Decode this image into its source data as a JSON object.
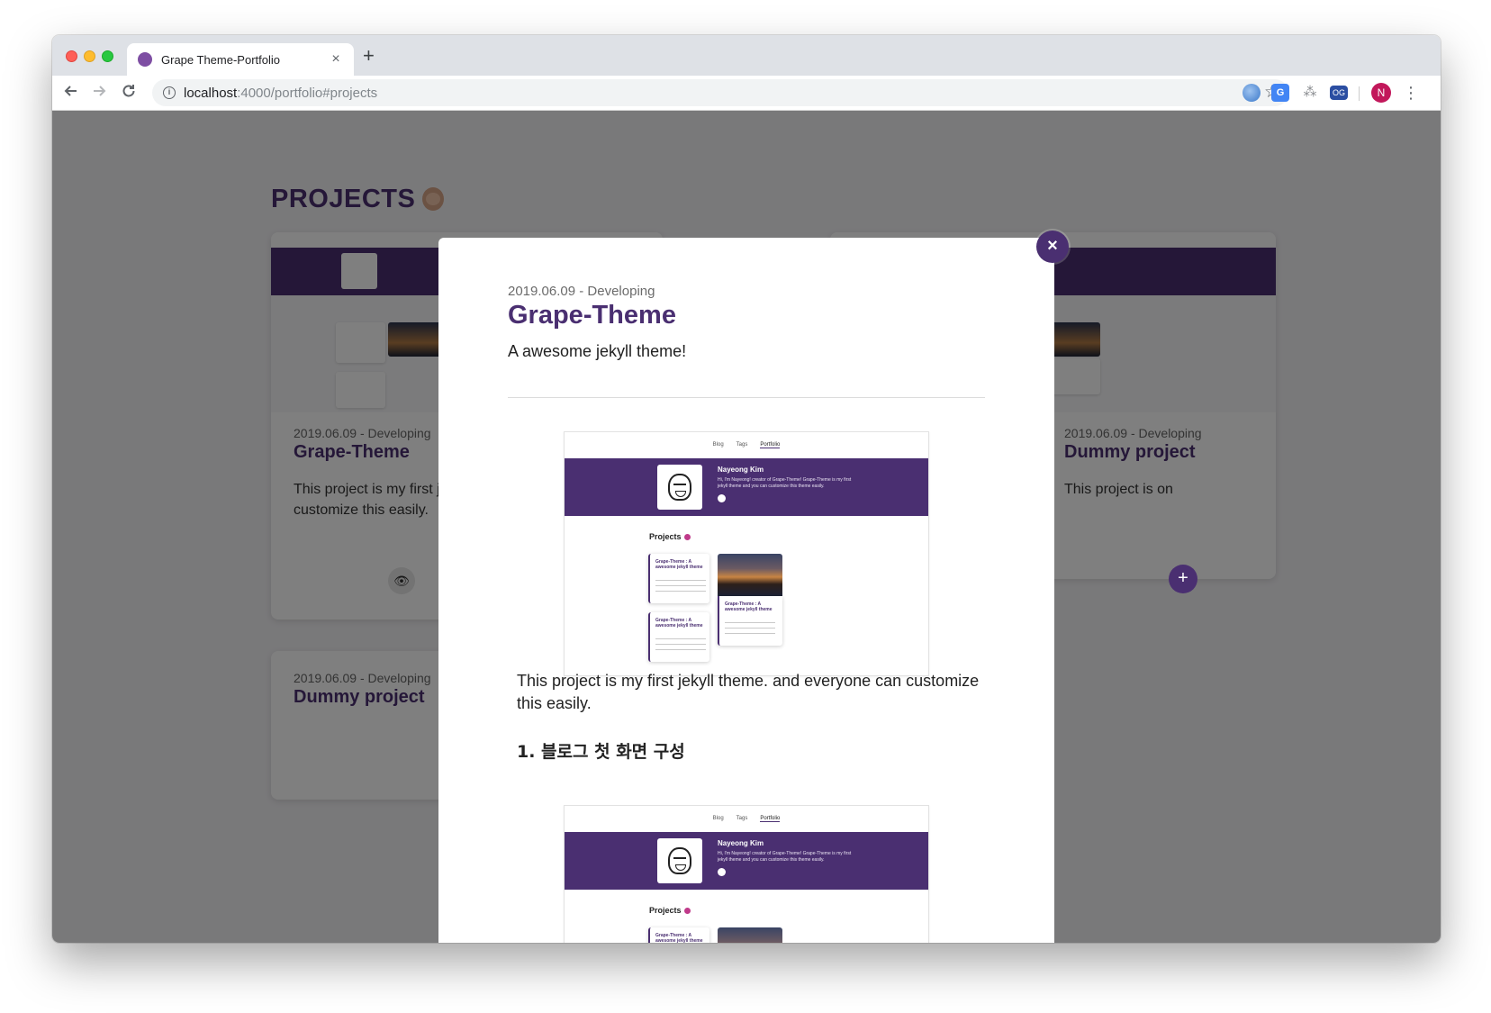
{
  "browser": {
    "tab_title": "Grape Theme-Portfolio",
    "tab_close": "×",
    "new_tab": "+",
    "url_host": "localhost",
    "url_rest": ":4000/portfolio#projects",
    "avatar_letter": "N",
    "ext_translate": "G",
    "ext_og": "OG",
    "icons": [
      "back-icon",
      "forward-icon",
      "reload-icon",
      "info-icon",
      "star-icon",
      "menu-icon"
    ]
  },
  "page": {
    "section_title": "PROJECTS",
    "cards": [
      {
        "date": "2019.06.09 - Developing",
        "title": "Grape-Theme",
        "description": "This project is my first jekyll theme. and everyone can customize this easily."
      },
      {
        "date": "2019.06.09 - Developing",
        "title": "Dummy project",
        "description": "This project is on"
      },
      {
        "date": "2019.06.09 - Developing",
        "title": "Dummy project",
        "description": ""
      }
    ]
  },
  "modal": {
    "close_label": "×",
    "date": "2019.06.09 - Developing",
    "title": "Grape-Theme",
    "subtitle": "A awesome jekyll theme!",
    "body": "This project is my first jekyll theme. and everyone can customize this easily.",
    "heading": "1. 블로그 첫 화면 구성",
    "screenshot": {
      "nav": [
        "Blog",
        "Tags",
        "Portfolio"
      ],
      "name": "Nayeong Kim",
      "bio": "Hi, I'm Nayeong! creator of Grape-Theme! Grape-Theme is my first jekyll theme and you can customize this theme easily.",
      "projects_label": "Projects",
      "card_title": "Grape-Theme : A awesome jekyll theme",
      "card_meta": "2019.06.09 · HTML,SCSS, JAVASCRIPT",
      "card_text": "this project is my first jekyll theme. and everyone can customize this easily."
    }
  },
  "colors": {
    "brand_purple": "#4a2f71",
    "overlay": "rgba(0,0,0,0.5)"
  }
}
